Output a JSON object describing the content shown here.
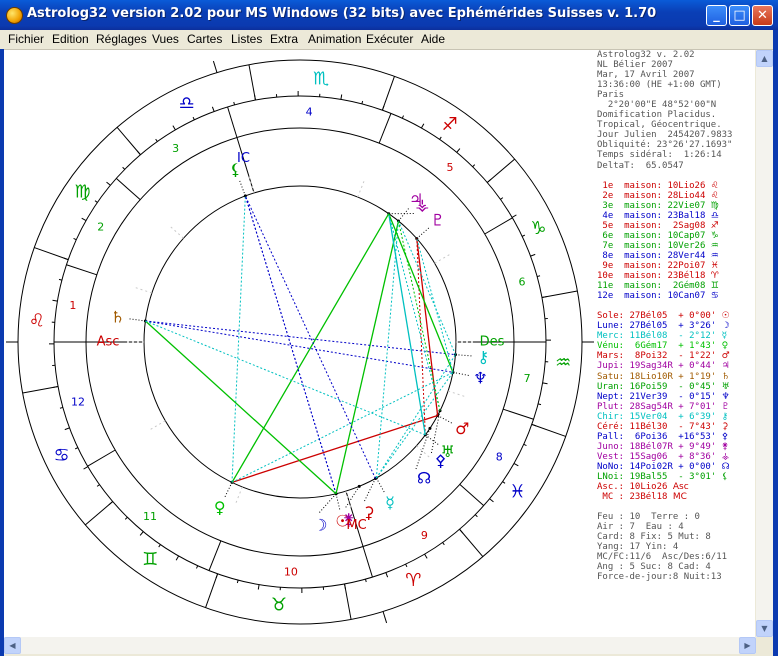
{
  "window": {
    "title": "Astrolog32 version 2.02 pour MS Windows (32 bits) avec Ephémérides Suisses v. 1.70",
    "minimize_glyph": "_",
    "maximize_glyph": "□",
    "close_glyph": "✕"
  },
  "menu": [
    "Fichier",
    "Edition",
    "Réglages",
    "Vues",
    "Cartes",
    "Listes",
    "Extra",
    "Animation",
    "Exécuter",
    "Aide"
  ],
  "info": {
    "header": [
      "Astrolog32 v. 2.02",
      "NL Bélier 2007",
      "Mar, 17 Avril 2007",
      "13:36:00 (HE +1:00 GMT)",
      "Paris",
      "  2°20'00\"E 48°52'00\"N",
      "Domification Placidus.",
      "Tropical, Géocentrique.",
      "Jour Julien  2454207.9833",
      "Obliquité: 23°26'27.1693\"",
      "Temps sidéral:  1:26:14",
      "DeltaT:  65.0547"
    ],
    "houses": [
      {
        "text": " 1e  maison: 10Lio26 ",
        "glyph": "♌",
        "color": "#cc0000"
      },
      {
        "text": " 2e  maison: 28Lio44 ",
        "glyph": "♌",
        "color": "#cc0000"
      },
      {
        "text": " 3e  maison: 22Vie07 ",
        "glyph": "♍",
        "color": "#00a000"
      },
      {
        "text": " 4e  maison: 23Bal18 ",
        "glyph": "♎",
        "color": "#0000c8"
      },
      {
        "text": " 5e  maison:  2Sag08 ",
        "glyph": "♐",
        "color": "#cc0000"
      },
      {
        "text": " 6e  maison: 10Cap07 ",
        "glyph": "♑",
        "color": "#00a000"
      },
      {
        "text": " 7e  maison: 10Ver26 ",
        "glyph": "♒",
        "color": "#00a000"
      },
      {
        "text": " 8e  maison: 28Ver44 ",
        "glyph": "♒",
        "color": "#0000c8"
      },
      {
        "text": " 9e  maison: 22Poi07 ",
        "glyph": "♓",
        "color": "#cc0000"
      },
      {
        "text": "10e  maison: 23Bél18 ",
        "glyph": "♈",
        "color": "#cc0000"
      },
      {
        "text": "11e  maison:  2Gém08 ",
        "glyph": "♊",
        "color": "#00a000"
      },
      {
        "text": "12e  maison: 10Can07 ",
        "glyph": "♋",
        "color": "#0000c8"
      }
    ],
    "planets": [
      {
        "text": "Sole: 27Bél05  + 0°00' ",
        "glyph": "☉",
        "color": "#cc0000"
      },
      {
        "text": "Lune: 27Bél05  + 3°26' ",
        "glyph": "☽",
        "color": "#0000c8"
      },
      {
        "text": "Merc: 11Bél08  - 2°12' ",
        "glyph": "☿",
        "color": "#00c0c0"
      },
      {
        "text": "Vénu:  6Gém17  + 1°43' ",
        "glyph": "♀",
        "color": "#00c000"
      },
      {
        "text": "Mars:  8Poi32  - 1°22' ",
        "glyph": "♂",
        "color": "#cc0000"
      },
      {
        "text": "Jupi: 19Sag34R + 0°44' ",
        "glyph": "♃",
        "color": "#a000a0"
      },
      {
        "text": "Satu: 18Lio10R + 1°19' ",
        "glyph": "♄",
        "color": "#a05a00"
      },
      {
        "text": "Uran: 16Poi59  - 0°45' ",
        "glyph": "♅",
        "color": "#00a000"
      },
      {
        "text": "Nept: 21Ver39  - 0°15' ",
        "glyph": "♆",
        "color": "#0000c8"
      },
      {
        "text": "Plut: 28Sag54R + 7°01' ",
        "glyph": "♇",
        "color": "#a000a0"
      },
      {
        "text": "Chir: 15Ver04  + 6°39' ",
        "glyph": "⚷",
        "color": "#00c0c0"
      },
      {
        "text": "Céré: 11Bél30  - 7°43' ",
        "glyph": "⚳",
        "color": "#cc0000"
      },
      {
        "text": "Pall:  6Poi36  +16°53' ",
        "glyph": "⚴",
        "color": "#0000c8"
      },
      {
        "text": "Juno: 18Bél07R + 9°49' ",
        "glyph": "⚵",
        "color": "#a000a0"
      },
      {
        "text": "Vest: 15Sag06  + 8°36' ",
        "glyph": "⚶",
        "color": "#a000a0"
      },
      {
        "text": "NoNo: 14Poi02R + 0°00' ",
        "glyph": "☊",
        "color": "#0000c8"
      },
      {
        "text": "LNoi: 19Bal55  - 3°01' ",
        "glyph": "⚸",
        "color": "#00a000"
      },
      {
        "text": "Asc.: 10Lio26 ",
        "glyph": "Asc",
        "color": "#cc0000"
      },
      {
        "text": " MC : 23Bél18 ",
        "glyph": "MC",
        "color": "#cc0000"
      }
    ],
    "footer": [
      "Feu : 10  Terre : 0",
      "Air : 7  Eau : 4",
      "Card: 8 Fix: 5 Mut: 8",
      "Yang: 17 Yin: 4",
      "MC/FC:11/6  Asc/Des:6/11",
      "Ang : 5 Suc: 8 Cad: 4",
      "Force-de-jour:8 Nuit:13"
    ]
  },
  "wheel": {
    "signs": [
      {
        "glyph": "♌",
        "color": "#cc0000"
      },
      {
        "glyph": "♍",
        "color": "#00a000"
      },
      {
        "glyph": "♎",
        "color": "#0000c8"
      },
      {
        "glyph": "♏",
        "color": "#00c0c0"
      },
      {
        "glyph": "♐",
        "color": "#cc0000"
      },
      {
        "glyph": "♑",
        "color": "#00a000"
      },
      {
        "glyph": "♒",
        "color": "#00a000"
      },
      {
        "glyph": "♓",
        "color": "#0000c8"
      },
      {
        "glyph": "♈",
        "color": "#cc0000"
      },
      {
        "glyph": "♉",
        "color": "#00a000"
      },
      {
        "glyph": "♊",
        "color": "#00a000"
      },
      {
        "glyph": "♋",
        "color": "#0000c8"
      }
    ],
    "house_numbers": [
      {
        "label": "1",
        "color": "#cc0000"
      },
      {
        "label": "2",
        "color": "#00a000"
      },
      {
        "label": "3",
        "color": "#00a000"
      },
      {
        "label": "4",
        "color": "#0000c8"
      },
      {
        "label": "5",
        "color": "#cc0000"
      },
      {
        "label": "6",
        "color": "#00a000"
      },
      {
        "label": "7",
        "color": "#00a000"
      },
      {
        "label": "8",
        "color": "#0000c8"
      },
      {
        "label": "9",
        "color": "#cc0000"
      },
      {
        "label": "10",
        "color": "#cc0000"
      },
      {
        "label": "11",
        "color": "#00a000"
      },
      {
        "label": "12",
        "color": "#0000c8"
      }
    ],
    "cusp_degrees": [
      130.43,
      148.73,
      172.12,
      203.3,
      242.13,
      280.12,
      310.43,
      328.73,
      352.12,
      23.3,
      62.13,
      100.12
    ],
    "angles": [
      {
        "label": "Asc",
        "degree": 130.43,
        "color": "#cc0000"
      },
      {
        "label": "MC",
        "degree": 23.3,
        "color": "#cc0000"
      },
      {
        "label": "Des",
        "degree": 310.43,
        "color": "#00a000"
      },
      {
        "label": "IC",
        "degree": 203.3,
        "color": "#0000c8"
      }
    ],
    "planets": [
      {
        "name": "Sole",
        "glyph": "☉",
        "degree": 27.08,
        "color": "#cc0000"
      },
      {
        "name": "Lune",
        "glyph": "☽",
        "degree": 27.08,
        "color": "#0000c8"
      },
      {
        "name": "Merc",
        "glyph": "☿",
        "degree": 11.13,
        "color": "#00c0c0"
      },
      {
        "name": "Vénu",
        "glyph": "♀",
        "degree": 66.28,
        "color": "#00c000"
      },
      {
        "name": "Mars",
        "glyph": "♂",
        "degree": 338.53,
        "color": "#cc0000"
      },
      {
        "name": "Jupi",
        "glyph": "♃",
        "degree": 259.57,
        "color": "#a000a0"
      },
      {
        "name": "Satu",
        "glyph": "♄",
        "degree": 138.17,
        "color": "#a05a00"
      },
      {
        "name": "Uran",
        "glyph": "♅",
        "degree": 346.98,
        "color": "#00a000"
      },
      {
        "name": "Nept",
        "glyph": "♆",
        "degree": 321.65,
        "color": "#0000c8"
      },
      {
        "name": "Plut",
        "glyph": "♇",
        "degree": 268.9,
        "color": "#a000a0"
      },
      {
        "name": "Chir",
        "glyph": "⚷",
        "degree": 315.07,
        "color": "#00c0c0"
      },
      {
        "name": "Céré",
        "glyph": "⚳",
        "degree": 11.5,
        "color": "#cc0000"
      },
      {
        "name": "Pall",
        "glyph": "⚴",
        "degree": 336.6,
        "color": "#0000c8"
      },
      {
        "name": "Juno",
        "glyph": "⚵",
        "degree": 18.12,
        "color": "#a000a0"
      },
      {
        "name": "Vest",
        "glyph": "⚶",
        "degree": 255.1,
        "color": "#a000a0"
      },
      {
        "name": "NoNo",
        "glyph": "☊",
        "degree": 344.03,
        "color": "#0000c8"
      },
      {
        "name": "LNoi",
        "glyph": "⚸",
        "degree": 199.92,
        "color": "#00a000"
      }
    ],
    "aspects": [
      {
        "from": "Vénu",
        "to": "Mars",
        "color": "#cc0000",
        "dashed": false
      },
      {
        "from": "Vénu",
        "to": "Nept",
        "color": "#00c0c0",
        "dashed": true
      },
      {
        "from": "Vénu",
        "to": "Vest",
        "color": "#00c000",
        "dashed": false
      },
      {
        "from": "Vénu",
        "to": "LNoi",
        "color": "#00c0c0",
        "dashed": true
      },
      {
        "from": "Sole",
        "to": "LNoi",
        "color": "#0000c8",
        "dashed": true
      },
      {
        "from": "Lune",
        "to": "LNoi",
        "color": "#0000c8",
        "dashed": true
      },
      {
        "from": "Sole",
        "to": "Satu",
        "color": "#00c000",
        "dashed": false
      },
      {
        "from": "Sole",
        "to": "Jupi",
        "color": "#00c000",
        "dashed": false
      },
      {
        "from": "Satu",
        "to": "Nept",
        "color": "#0000c8",
        "dashed": true
      },
      {
        "from": "Satu",
        "to": "Chir",
        "color": "#0000c8",
        "dashed": true
      },
      {
        "from": "Satu",
        "to": "Uran",
        "color": "#00c0c0",
        "dashed": true
      },
      {
        "from": "Merc",
        "to": "Jupi",
        "color": "#00c0c0",
        "dashed": true
      },
      {
        "from": "Merc",
        "to": "Nept",
        "color": "#00c0c0",
        "dashed": true
      },
      {
        "from": "Mars",
        "to": "Plut",
        "color": "#cc0000",
        "dashed": false
      },
      {
        "from": "Uran",
        "to": "Plut",
        "color": "#cc0000",
        "dashed": true
      },
      {
        "from": "Uran",
        "to": "Vest",
        "color": "#00c0c0",
        "dashed": false
      },
      {
        "from": "Nept",
        "to": "Vest",
        "color": "#00c000",
        "dashed": false
      },
      {
        "from": "Chir",
        "to": "Jupi",
        "color": "#00c0c0",
        "dashed": true
      },
      {
        "from": "Pall",
        "to": "Vest",
        "color": "#00c0c0",
        "dashed": true
      },
      {
        "from": "Pall",
        "to": "Jupi",
        "color": "#00c000",
        "dashed": true
      },
      {
        "from": "Nept",
        "to": "Plut",
        "color": "#00c0c0",
        "dashed": true
      },
      {
        "from": "Merc",
        "to": "Chir",
        "color": "#00c0c0",
        "dashed": true
      },
      {
        "from": "Céré",
        "to": "LNoi",
        "color": "#0000c8",
        "dashed": true
      }
    ]
  }
}
